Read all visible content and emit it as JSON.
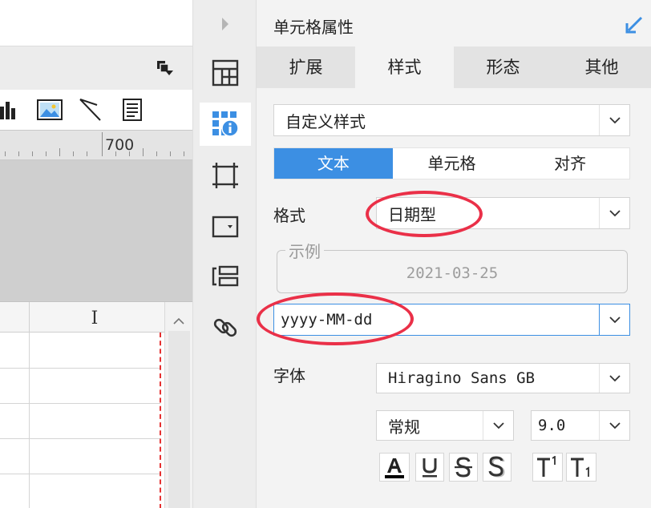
{
  "ruler": {
    "label": "700"
  },
  "grid": {
    "column_header": "I"
  },
  "panel": {
    "title": "单元格属性",
    "tabs": [
      {
        "label": "扩展"
      },
      {
        "label": "样式",
        "active": true
      },
      {
        "label": "形态"
      },
      {
        "label": "其他"
      }
    ],
    "style_select": {
      "value": "自定义样式"
    },
    "segments": [
      {
        "label": "文本",
        "active": true
      },
      {
        "label": "单元格"
      },
      {
        "label": "对齐"
      }
    ],
    "format": {
      "label": "格式",
      "value": "日期型"
    },
    "example": {
      "legend": "示例",
      "value": "2021-03-25"
    },
    "pattern": {
      "value": "yyyy-MM-dd"
    },
    "font": {
      "label": "字体",
      "family": "Hiragino Sans GB",
      "style": "常规",
      "size": "9.0"
    }
  },
  "colors": {
    "accent": "#3c8fe3",
    "annotation": "#ea3048",
    "icon_blue": "#3c8fe3"
  }
}
